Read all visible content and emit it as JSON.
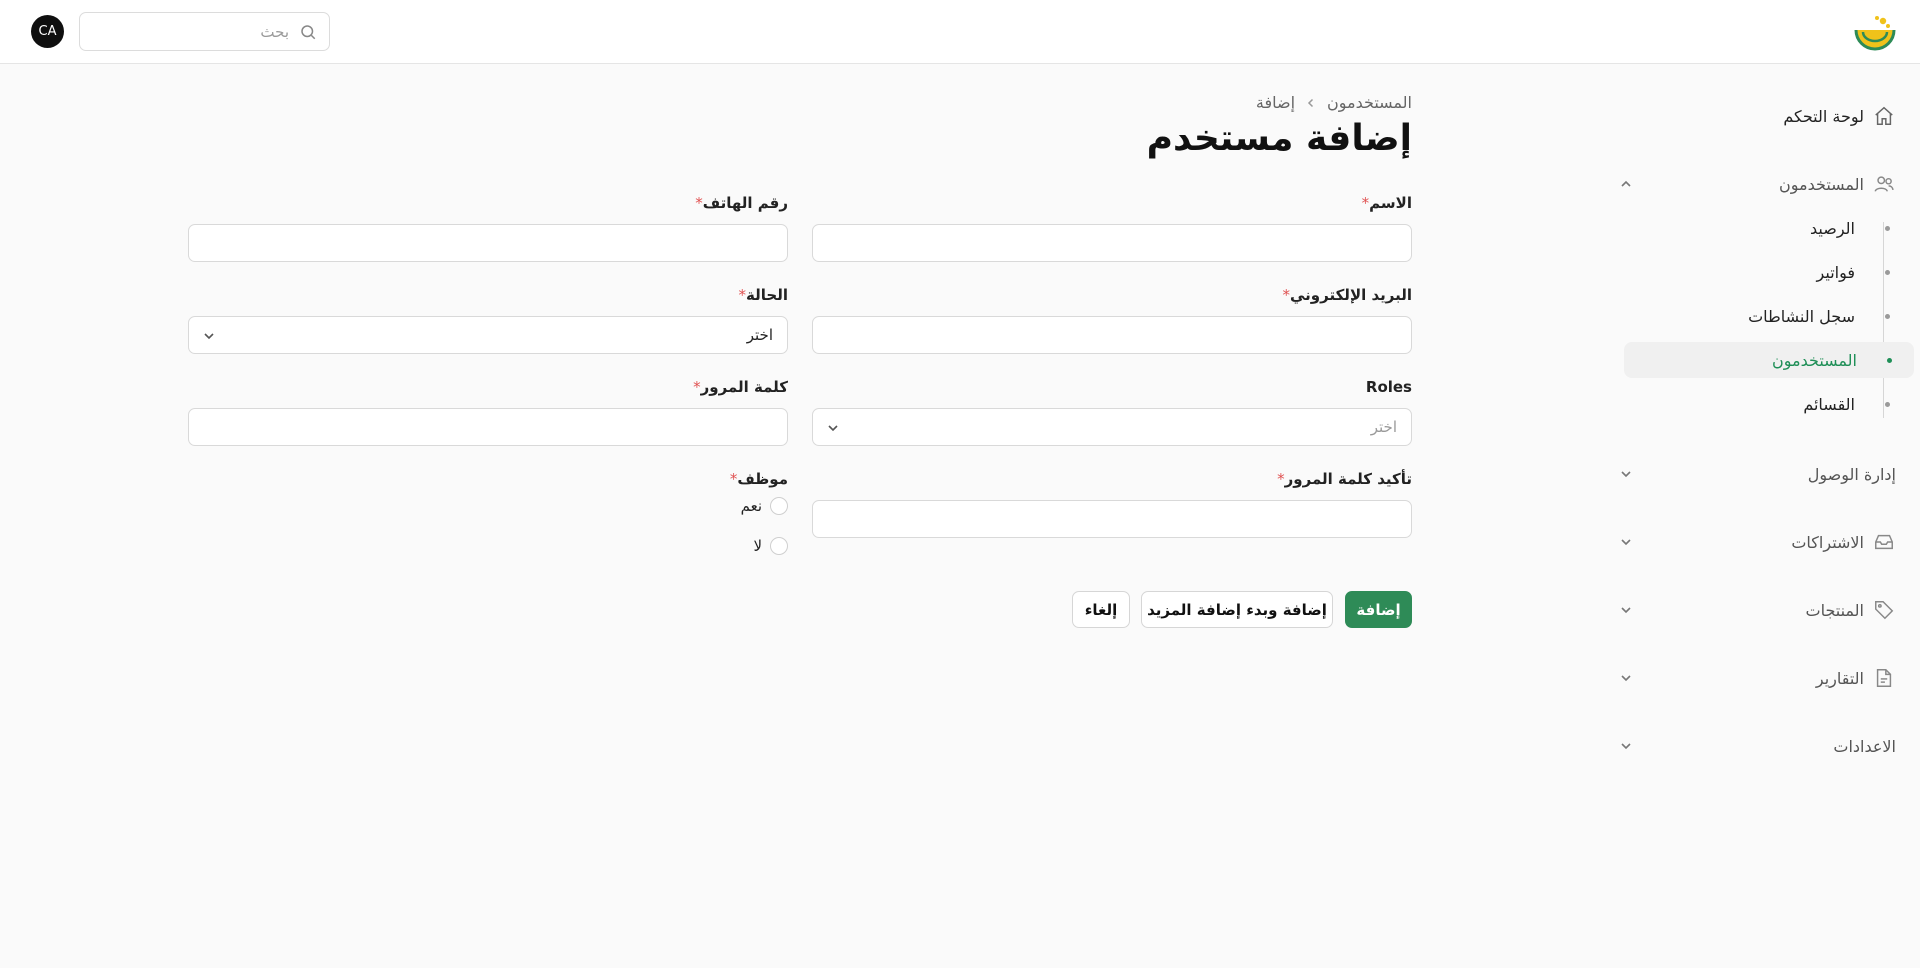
{
  "header": {
    "avatar_initials": "CA",
    "search_placeholder": "بحث"
  },
  "sidebar": {
    "items": [
      {
        "label": "لوحة التحكم",
        "icon": "home-icon"
      },
      {
        "label": "المستخدمون",
        "icon": "users-icon",
        "expanded": true,
        "children": [
          {
            "label": "الرصيد"
          },
          {
            "label": "فواتير"
          },
          {
            "label": "سجل النشاطات"
          },
          {
            "label": "المستخدمون",
            "active": true
          },
          {
            "label": "القسائم"
          }
        ]
      },
      {
        "label": "إدارة الوصول",
        "icon": ""
      },
      {
        "label": "الاشتراكات",
        "icon": "archive-icon"
      },
      {
        "label": "المنتجات",
        "icon": "tag-icon"
      },
      {
        "label": "التقارير",
        "icon": "document-icon"
      },
      {
        "label": "الاعدادات",
        "icon": ""
      }
    ]
  },
  "breadcrumb": {
    "parent": "المستخدمون",
    "current": "إضافة"
  },
  "page": {
    "title": "إضافة مستخدم"
  },
  "form": {
    "name_label": "الاسم",
    "phone_label": "رقم الهاتف",
    "email_label": "البريد الإلكتروني",
    "status_label": "الحالة",
    "status_value": "اختر",
    "roles_label": "Roles",
    "roles_placeholder": "اختر",
    "password_label": "كلمة المرور",
    "confirm_password_label": "تأكيد كلمة المرور",
    "employee_label": "موظف",
    "employee_yes": "نعم",
    "employee_no": "لا",
    "required_mark": "*"
  },
  "actions": {
    "add": "إضافة",
    "add_and_more": "إضافة وبدء إضافة المزيد",
    "cancel": "إلغاء"
  },
  "colors": {
    "primary": "#2e8b57",
    "active_nav": "#1f8f57",
    "required": "#e05252"
  }
}
